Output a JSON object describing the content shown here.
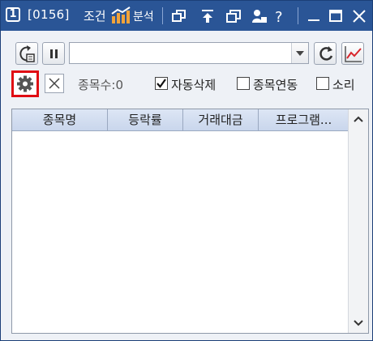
{
  "window": {
    "number_badge": "1",
    "screen_code": "[0156]",
    "title": "조건",
    "analysis_label": "분석"
  },
  "toolbar": {
    "condition_select": {
      "value": ""
    }
  },
  "options": {
    "stock_count_label": "종목수:0",
    "auto_delete": {
      "label": "자동삭제",
      "checked": true
    },
    "stock_link": {
      "label": "종목연동",
      "checked": false
    },
    "sound": {
      "label": "소리",
      "checked": false
    }
  },
  "grid": {
    "columns": [
      "종목명",
      "등락률",
      "거래대금",
      "프로그램..."
    ],
    "rows": []
  },
  "colors": {
    "titlebar": "#2a5596",
    "settings_highlight": "#e00c13",
    "header_bg": "#c9d6ec"
  }
}
